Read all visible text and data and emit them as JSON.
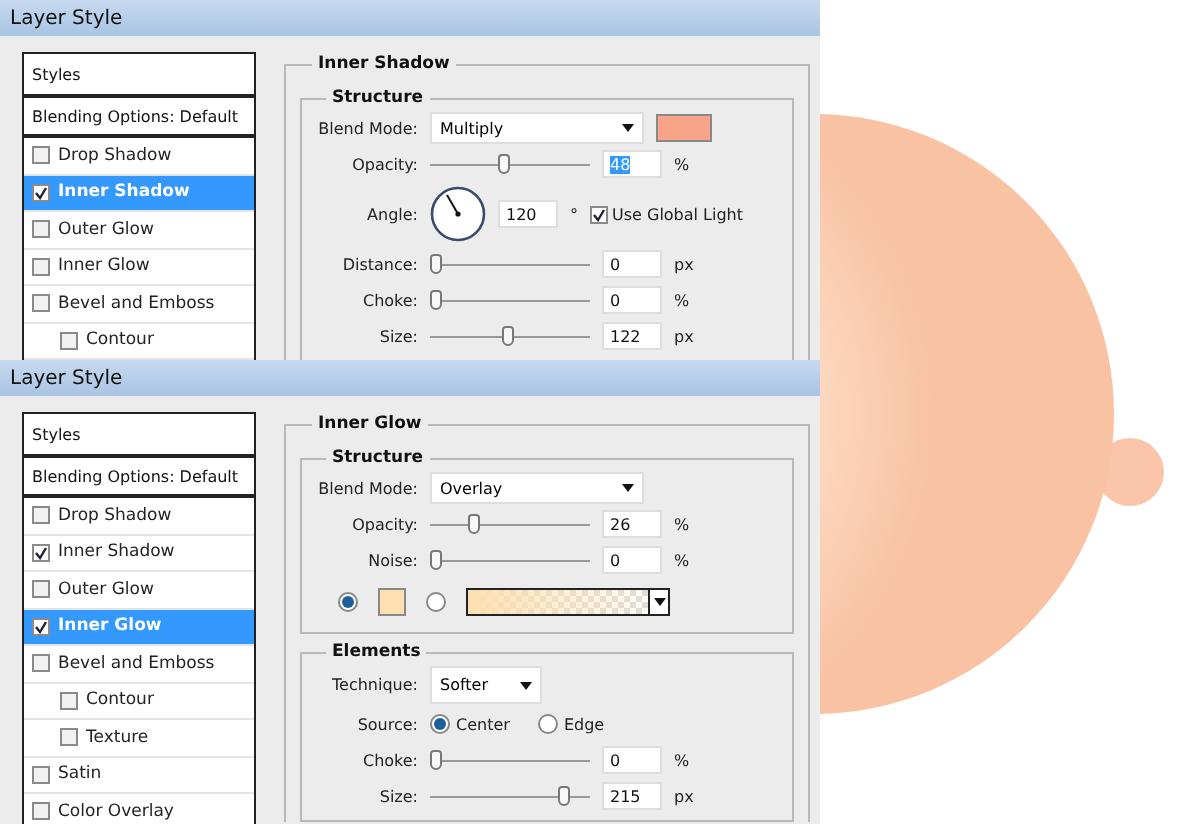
{
  "dialogs": [
    {
      "title": "Layer Style",
      "headers": [
        {
          "label": "Styles",
          "selected": false
        },
        {
          "label": "Blending Options: Default",
          "selected": false
        }
      ],
      "effects": [
        {
          "label": "Drop Shadow",
          "checked": false,
          "selected": false
        },
        {
          "label": "Inner Shadow",
          "checked": true,
          "selected": true
        },
        {
          "label": "Outer Glow",
          "checked": false,
          "selected": false
        },
        {
          "label": "Inner Glow",
          "checked": false,
          "selected": false
        },
        {
          "label": "Bevel and Emboss",
          "checked": false,
          "selected": false,
          "children": [
            {
              "label": "Contour",
              "checked": false,
              "selected": false
            }
          ]
        }
      ],
      "section": {
        "title": "Inner Shadow",
        "groups": [
          {
            "title": "Structure",
            "rows": [
              {
                "kind": "select",
                "label": "Blend Mode:",
                "value": "Multiply",
                "color": "#f8a486"
              },
              {
                "kind": "slider",
                "label": "Opacity:",
                "level": 0.46,
                "value": "48",
                "unit": "%",
                "text_selected": true
              },
              {
                "kind": "angle",
                "label": "Angle:",
                "value": "120",
                "unit": "°",
                "checkbox": {
                  "label": "Use Global Light",
                  "checked": true
                }
              },
              {
                "kind": "slider",
                "label": "Distance:",
                "level": 0,
                "value": "0",
                "unit": "px",
                "text_selected": false
              },
              {
                "kind": "slider",
                "label": "Choke:",
                "level": 0,
                "value": "0",
                "unit": "%",
                "text_selected": false
              },
              {
                "kind": "slider",
                "label": "Size:",
                "level": 0.49,
                "value": "122",
                "unit": "px",
                "text_selected": false
              }
            ]
          }
        ]
      }
    },
    {
      "title": "Layer Style",
      "headers": [
        {
          "label": "Styles",
          "selected": false
        },
        {
          "label": "Blending Options: Default",
          "selected": false
        }
      ],
      "effects": [
        {
          "label": "Drop Shadow",
          "checked": false,
          "selected": false
        },
        {
          "label": "Inner Shadow",
          "checked": true,
          "selected": false
        },
        {
          "label": "Outer Glow",
          "checked": false,
          "selected": false
        },
        {
          "label": "Inner Glow",
          "checked": true,
          "selected": true
        },
        {
          "label": "Bevel and Emboss",
          "checked": false,
          "selected": false,
          "children": [
            {
              "label": "Contour",
              "checked": false,
              "selected": false
            },
            {
              "label": "Texture",
              "checked": false,
              "selected": false
            }
          ]
        },
        {
          "label": "Satin",
          "checked": false,
          "selected": false
        },
        {
          "label": "Color Overlay",
          "checked": false,
          "selected": false
        }
      ],
      "section": {
        "title": "Inner Glow",
        "groups": [
          {
            "title": "Structure",
            "rows": [
              {
                "kind": "select",
                "label": "Blend Mode:",
                "value": "Overlay"
              },
              {
                "kind": "slider",
                "label": "Opacity:",
                "level": 0.26,
                "value": "26",
                "unit": "%",
                "text_selected": false
              },
              {
                "kind": "slider",
                "label": "Noise:",
                "level": 0,
                "value": "0",
                "unit": "%",
                "text_selected": false
              },
              {
                "kind": "fill",
                "options": [
                  {
                    "kind": "swatch",
                    "selected": true,
                    "color": "#fde0b0"
                  },
                  {
                    "kind": "gradient",
                    "selected": false,
                    "color": "#fde0b0"
                  }
                ]
              }
            ]
          },
          {
            "title": "Elements",
            "rows": [
              {
                "kind": "select",
                "label": "Technique:",
                "value": "Softer",
                "narrow": true
              },
              {
                "kind": "radio",
                "label": "Source:",
                "options": [
                  {
                    "label": "Center",
                    "selected": true
                  },
                  {
                    "label": "Edge",
                    "selected": false
                  }
                ]
              },
              {
                "kind": "slider",
                "label": "Choke:",
                "level": 0,
                "value": "0",
                "unit": "%",
                "text_selected": false
              },
              {
                "kind": "slider",
                "label": "Size:",
                "level": 0.86,
                "value": "215",
                "unit": "px",
                "text_selected": false
              }
            ]
          }
        ]
      }
    }
  ]
}
